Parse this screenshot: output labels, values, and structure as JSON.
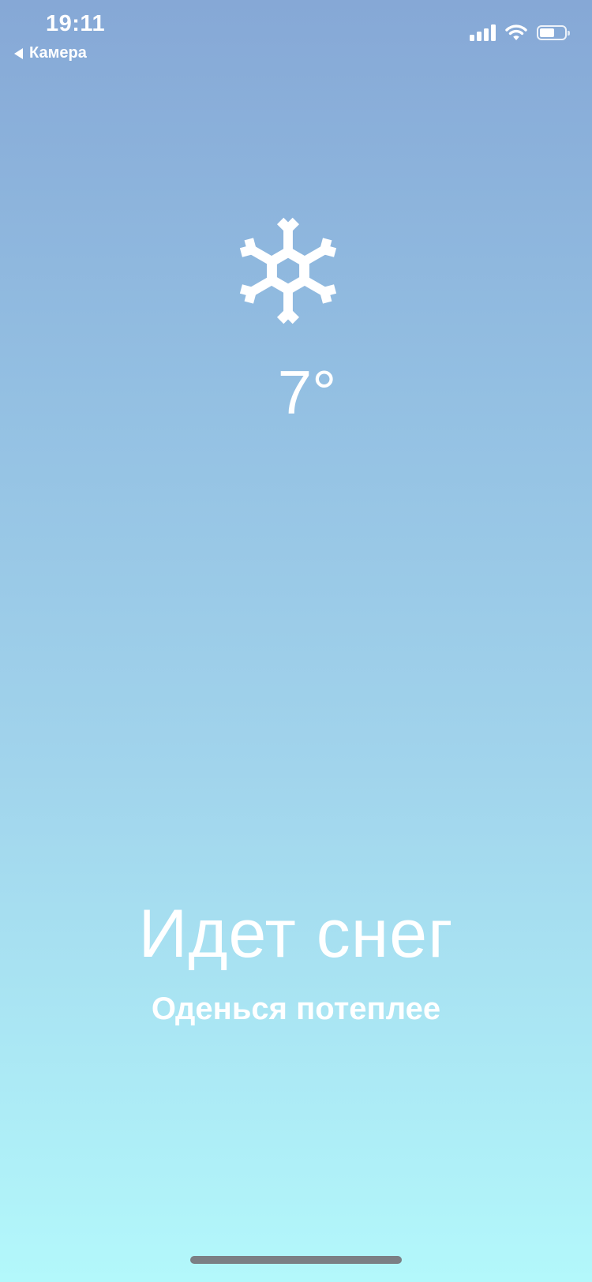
{
  "status_bar": {
    "time": "19:11",
    "back_label": "Камера",
    "signal_bars": 4,
    "battery_level_percent": 60,
    "icons": [
      "signal-icon",
      "wifi-icon",
      "battery-icon"
    ]
  },
  "weather": {
    "icon": "snowflake-icon",
    "temperature": "7°",
    "condition": "Идет снег",
    "advice": "Оденься потеплее"
  },
  "colors": {
    "gradient_top": "#86a8d6",
    "gradient_bottom": "#b3f8fb",
    "text": "#ffffff",
    "home_indicator": "#7b7f84"
  }
}
